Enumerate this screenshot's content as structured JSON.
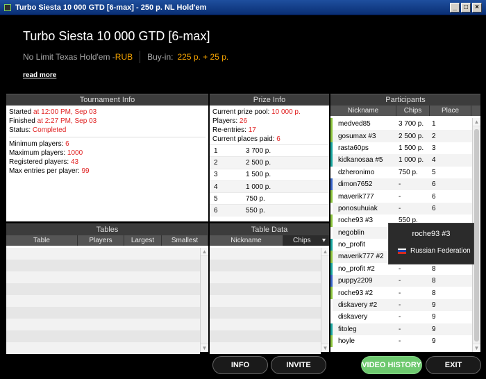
{
  "window": {
    "title": "Turbo Siesta 10 000 GTD [6-max] - 250 р. NL Hold'em",
    "minimize": "_",
    "maximize": "□",
    "close": "×"
  },
  "header": {
    "tournament_name": "Turbo Siesta 10 000 GTD [6-max]",
    "game": "No Limit Texas Hold'em - ",
    "currency": "RUB",
    "buyin_label": "Buy-in:",
    "buyin_value": "225 р. + 25 р.",
    "read_more": "read more"
  },
  "tournament_info": {
    "title": "Tournament Info",
    "started_label": "Started ",
    "started_value": "at 12:00 PM, Sep 03",
    "finished_label": "Finished ",
    "finished_value": "at 2:27 PM, Sep 03",
    "status_label": "Status: ",
    "status_value": "Completed",
    "min_players_label": "Minimum players: ",
    "min_players_value": "6",
    "max_players_label": "Maximum players: ",
    "max_players_value": "1000",
    "registered_label": "Registered players: ",
    "registered_value": "43",
    "max_entries_label": "Max entries per player: ",
    "max_entries_value": "99"
  },
  "prize_info": {
    "title": "Prize Info",
    "pool_label": "Current prize pool: ",
    "pool_value": "10 000 р.",
    "players_label": "Players: ",
    "players_value": "26",
    "reentries_label": "Re-entries: ",
    "reentries_value": "17",
    "places_label": "Current places paid: ",
    "places_value": "6",
    "rows": [
      {
        "pos": "1",
        "prize": "3 700 р."
      },
      {
        "pos": "2",
        "prize": "2 500 р."
      },
      {
        "pos": "3",
        "prize": "1 500 р."
      },
      {
        "pos": "4",
        "prize": "1 000 р."
      },
      {
        "pos": "5",
        "prize": "750 р."
      },
      {
        "pos": "6",
        "prize": "550 р."
      }
    ]
  },
  "participants": {
    "title": "Participants",
    "col_nickname": "Nickname",
    "col_chips": "Chips",
    "col_place": "Place",
    "rows": [
      {
        "nick": "medved85",
        "chips": "3 700 р.",
        "place": "1",
        "color": "#8dc63f"
      },
      {
        "nick": "gosumax #3",
        "chips": "2 500 р.",
        "place": "2",
        "color": "#8dc63f"
      },
      {
        "nick": "rasta60ps",
        "chips": "1 500 р.",
        "place": "3",
        "color": "#1aa7a0"
      },
      {
        "nick": "kidkanosaa #5",
        "chips": "1 000 р.",
        "place": "4",
        "color": "#1aa7a0"
      },
      {
        "nick": "dzheronimo",
        "chips": "750 р.",
        "place": "5",
        "color": "#ffffff"
      },
      {
        "nick": "dimon7652",
        "chips": "-",
        "place": "6",
        "color": "#3a66c8"
      },
      {
        "nick": "maverik777",
        "chips": "-",
        "place": "6",
        "color": "#8dc63f"
      },
      {
        "nick": "ponosuhuiak",
        "chips": "-",
        "place": "6",
        "color": "#ffffff"
      },
      {
        "nick": "roche93 #3",
        "chips": "550 р.",
        "place": "",
        "color": "#8dc63f"
      },
      {
        "nick": "negoblin",
        "chips": "",
        "place": "",
        "color": "#ffffff"
      },
      {
        "nick": "no_profit",
        "chips": "",
        "place": "",
        "color": "#1aa7a0"
      },
      {
        "nick": "maverik777 #2",
        "chips": "",
        "place": "",
        "color": "#8dc63f"
      },
      {
        "nick": "no_profit #2",
        "chips": "-",
        "place": "8",
        "color": "#1aa7a0"
      },
      {
        "nick": "puppy2209",
        "chips": "-",
        "place": "8",
        "color": "#3a66c8"
      },
      {
        "nick": "roche93 #2",
        "chips": "-",
        "place": "8",
        "color": "#8dc63f"
      },
      {
        "nick": "diskavery #2",
        "chips": "-",
        "place": "9",
        "color": "#ffffff"
      },
      {
        "nick": "diskavery",
        "chips": "-",
        "place": "9",
        "color": "#ffffff"
      },
      {
        "nick": "fitoleg",
        "chips": "-",
        "place": "9",
        "color": "#1aa7a0"
      },
      {
        "nick": "hoyle",
        "chips": "-",
        "place": "9",
        "color": "#8dc63f"
      }
    ]
  },
  "tooltip": {
    "name": "roche93 #3",
    "country": "Russian Federation"
  },
  "tables": {
    "title": "Tables",
    "col_table": "Table",
    "col_players": "Players",
    "col_largest": "Largest",
    "col_smallest": "Smallest"
  },
  "table_data": {
    "title": "Table Data",
    "col_nickname": "Nickname",
    "col_chips": "Chips",
    "sort_arrow": "▾"
  },
  "buttons": {
    "info": "INFO",
    "invite": "INVITE",
    "video_history": "VIDEO HISTORY",
    "exit": "EXIT"
  },
  "colors": {
    "accent_orange": "#f5a300",
    "value_red": "#e02020",
    "button_green": "#6ec96f"
  }
}
